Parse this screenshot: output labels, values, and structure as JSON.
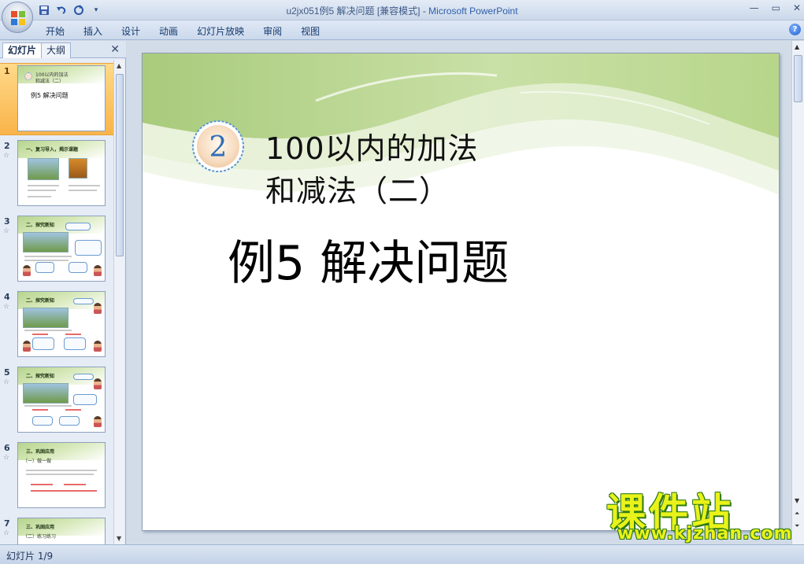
{
  "window": {
    "title_doc": "u2jx051例5  解决问题 [兼容模式] - ",
    "title_app": "Microsoft PowerPoint"
  },
  "quick_access": {
    "icons": [
      "save-icon",
      "undo-icon",
      "redo-icon",
      "customize-icon"
    ]
  },
  "ribbon": {
    "tabs": [
      "开始",
      "插入",
      "设计",
      "动画",
      "幻灯片放映",
      "审阅",
      "视图"
    ]
  },
  "left_pane": {
    "tab_slides": "幻灯片",
    "tab_outline": "大纲",
    "slides": [
      {
        "number": "1",
        "selected": true,
        "title_a": "100以内的加法",
        "title_b": "和减法（二）",
        "subtitle": "例5  解决问题"
      },
      {
        "number": "2",
        "selected": false,
        "heading": "一、复习导入，揭示课题"
      },
      {
        "number": "3",
        "selected": false,
        "heading": "二、探究新知"
      },
      {
        "number": "4",
        "selected": false,
        "heading": "二、探究新知"
      },
      {
        "number": "5",
        "selected": false,
        "heading": "二、探究新知"
      },
      {
        "number": "6",
        "selected": false,
        "heading": "三、巩固应用",
        "sub": "（一）做一做"
      },
      {
        "number": "7",
        "selected": false,
        "heading": "三、巩固应用",
        "sub": "（二）练习练习"
      }
    ]
  },
  "slide": {
    "unit_number": "2",
    "title_line1": "100以内的加法",
    "title_line2": "和减法（二）",
    "example_title": "例5  解决问题"
  },
  "watermark": {
    "brand": "课件站",
    "url": "www.kjzhan.com"
  },
  "status": {
    "text": "幻灯片 1/9"
  },
  "colors": {
    "accent_blue": "#2f5fa8",
    "selection": "#f9b449",
    "slide_wave_green": "#b6d48d",
    "watermark_yellow": "#e9f21a",
    "watermark_green": "#2e7a12"
  }
}
